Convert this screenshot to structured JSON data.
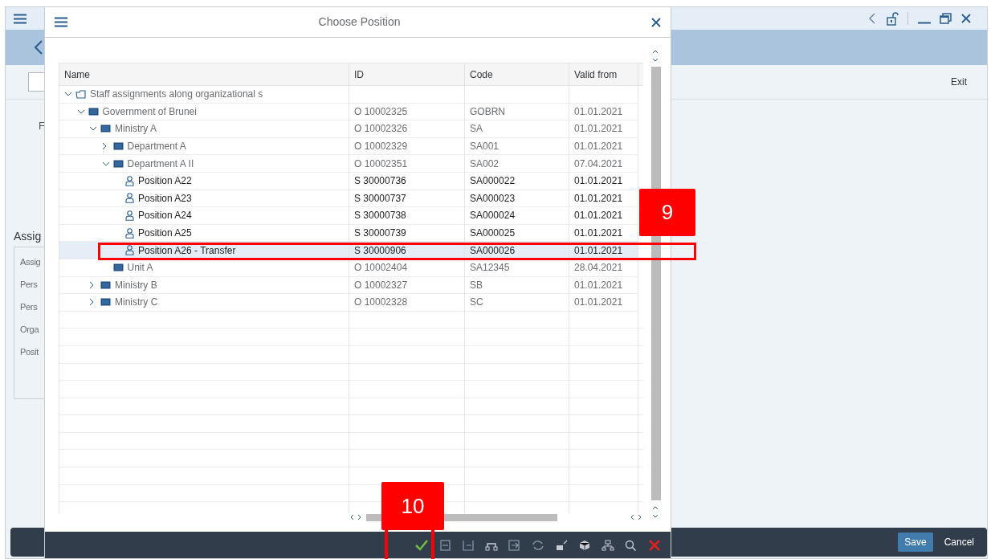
{
  "background_window": {
    "toolbar_action": "Exit",
    "left_labels": [
      "F",
      "Assig"
    ],
    "form_labels": [
      "Assig",
      "Pers",
      "Pers",
      "Orga",
      "Posit"
    ],
    "footer_buttons": [
      {
        "label": "Save",
        "kind": "primary"
      },
      {
        "label": "Cancel",
        "kind": "plain"
      }
    ]
  },
  "dialog": {
    "title": "Choose Position",
    "table": {
      "columns": [
        "Name",
        "ID",
        "Code",
        "Valid from"
      ],
      "rows": [
        {
          "kind": "root",
          "name": "Staff assignments along organizational s",
          "expanded": true,
          "selected": false,
          "children": [
            {
              "kind": "org",
              "name": "Government of Brunei",
              "id": "O 10002325",
              "code": "GOBRN",
              "valid_from": "01.01.2021",
              "expanded": true,
              "selected": false,
              "children": [
                {
                  "kind": "org",
                  "name": "Ministry A",
                  "id": "O 10002326",
                  "code": "SA",
                  "valid_from": "01.01.2021",
                  "expanded": true,
                  "selected": false,
                  "children": [
                    {
                      "kind": "org",
                      "name": "Department A",
                      "id": "O 10002329",
                      "code": "SA001",
                      "valid_from": "01.01.2021",
                      "expanded": false,
                      "selected": false
                    },
                    {
                      "kind": "org",
                      "name": "Department A II",
                      "id": "O 10002351",
                      "code": "SA002",
                      "valid_from": "07.04.2021",
                      "expanded": true,
                      "selected": false,
                      "children": [
                        {
                          "kind": "position",
                          "name": "Position A22",
                          "id": "S 30000736",
                          "code": "SA000022",
                          "valid_from": "01.01.2021",
                          "selected": false
                        },
                        {
                          "kind": "position",
                          "name": "Position A23",
                          "id": "S 30000737",
                          "code": "SA000023",
                          "valid_from": "01.01.2021",
                          "selected": false
                        },
                        {
                          "kind": "position",
                          "name": "Position A24",
                          "id": "S 30000738",
                          "code": "SA000024",
                          "valid_from": "01.01.2021",
                          "selected": false
                        },
                        {
                          "kind": "position",
                          "name": "Position A25",
                          "id": "S 30000739",
                          "code": "SA000025",
                          "valid_from": "01.01.2021",
                          "selected": false
                        },
                        {
                          "kind": "position",
                          "name": "Position A26 - Transfer",
                          "id": "S 30000906",
                          "code": "SA000026",
                          "valid_from": "01.01.2021",
                          "selected": true
                        }
                      ]
                    },
                    {
                      "kind": "org",
                      "name": "Unit A",
                      "id": "O 10002404",
                      "code": "SA12345",
                      "valid_from": "28.04.2021",
                      "selected": false
                    }
                  ]
                },
                {
                  "kind": "org",
                  "name": "Ministry B",
                  "id": "O 10002327",
                  "code": "SB",
                  "valid_from": "01.01.2021",
                  "expanded": false,
                  "selected": false
                },
                {
                  "kind": "org",
                  "name": "Ministry C",
                  "id": "O 10002328",
                  "code": "SC",
                  "valid_from": "01.01.2021",
                  "expanded": false,
                  "selected": false
                }
              ]
            }
          ]
        }
      ]
    }
  },
  "annotations": [
    {
      "label": "9"
    },
    {
      "label": "10"
    }
  ]
}
